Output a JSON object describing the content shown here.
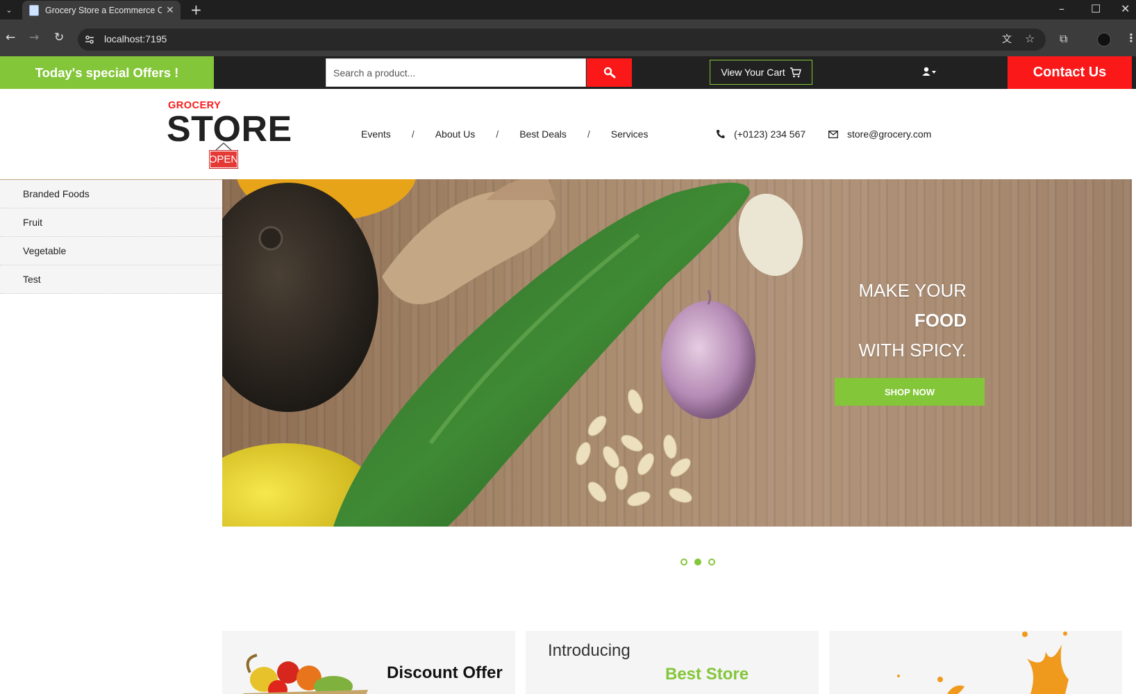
{
  "browser": {
    "tab_title": "Grocery Store a Ecommerce On",
    "url": "localhost:7195"
  },
  "topbar": {
    "special_offers": "Today's special Offers !",
    "search_placeholder": "Search a product...",
    "cart_label": "View Your Cart",
    "contact_label": "Contact Us"
  },
  "header": {
    "logo_small": "GROCERY",
    "logo_big": "STORE",
    "logo_sign": "OPEN",
    "nav": [
      {
        "label": "Events"
      },
      {
        "label": "About Us"
      },
      {
        "label": "Best Deals"
      },
      {
        "label": "Services"
      }
    ],
    "nav_separator": "/",
    "phone": "(+0123) 234 567",
    "email": "store@grocery.com"
  },
  "sidebar": {
    "items": [
      {
        "label": "Branded Foods"
      },
      {
        "label": "Fruit"
      },
      {
        "label": "Vegetable"
      },
      {
        "label": "Test"
      }
    ]
  },
  "hero": {
    "line1": "MAKE YOUR",
    "line2": "FOOD",
    "line3": "WITH SPICY.",
    "button": "SHOP NOW",
    "slides": 3,
    "active_slide": 2
  },
  "promos": {
    "card1_title": "Discount Offer",
    "card2_intro": "Introducing",
    "card2_title": "Best Store"
  },
  "colors": {
    "accent_green": "#84c639",
    "accent_red": "#fa1818",
    "dark_bar": "#212121"
  }
}
